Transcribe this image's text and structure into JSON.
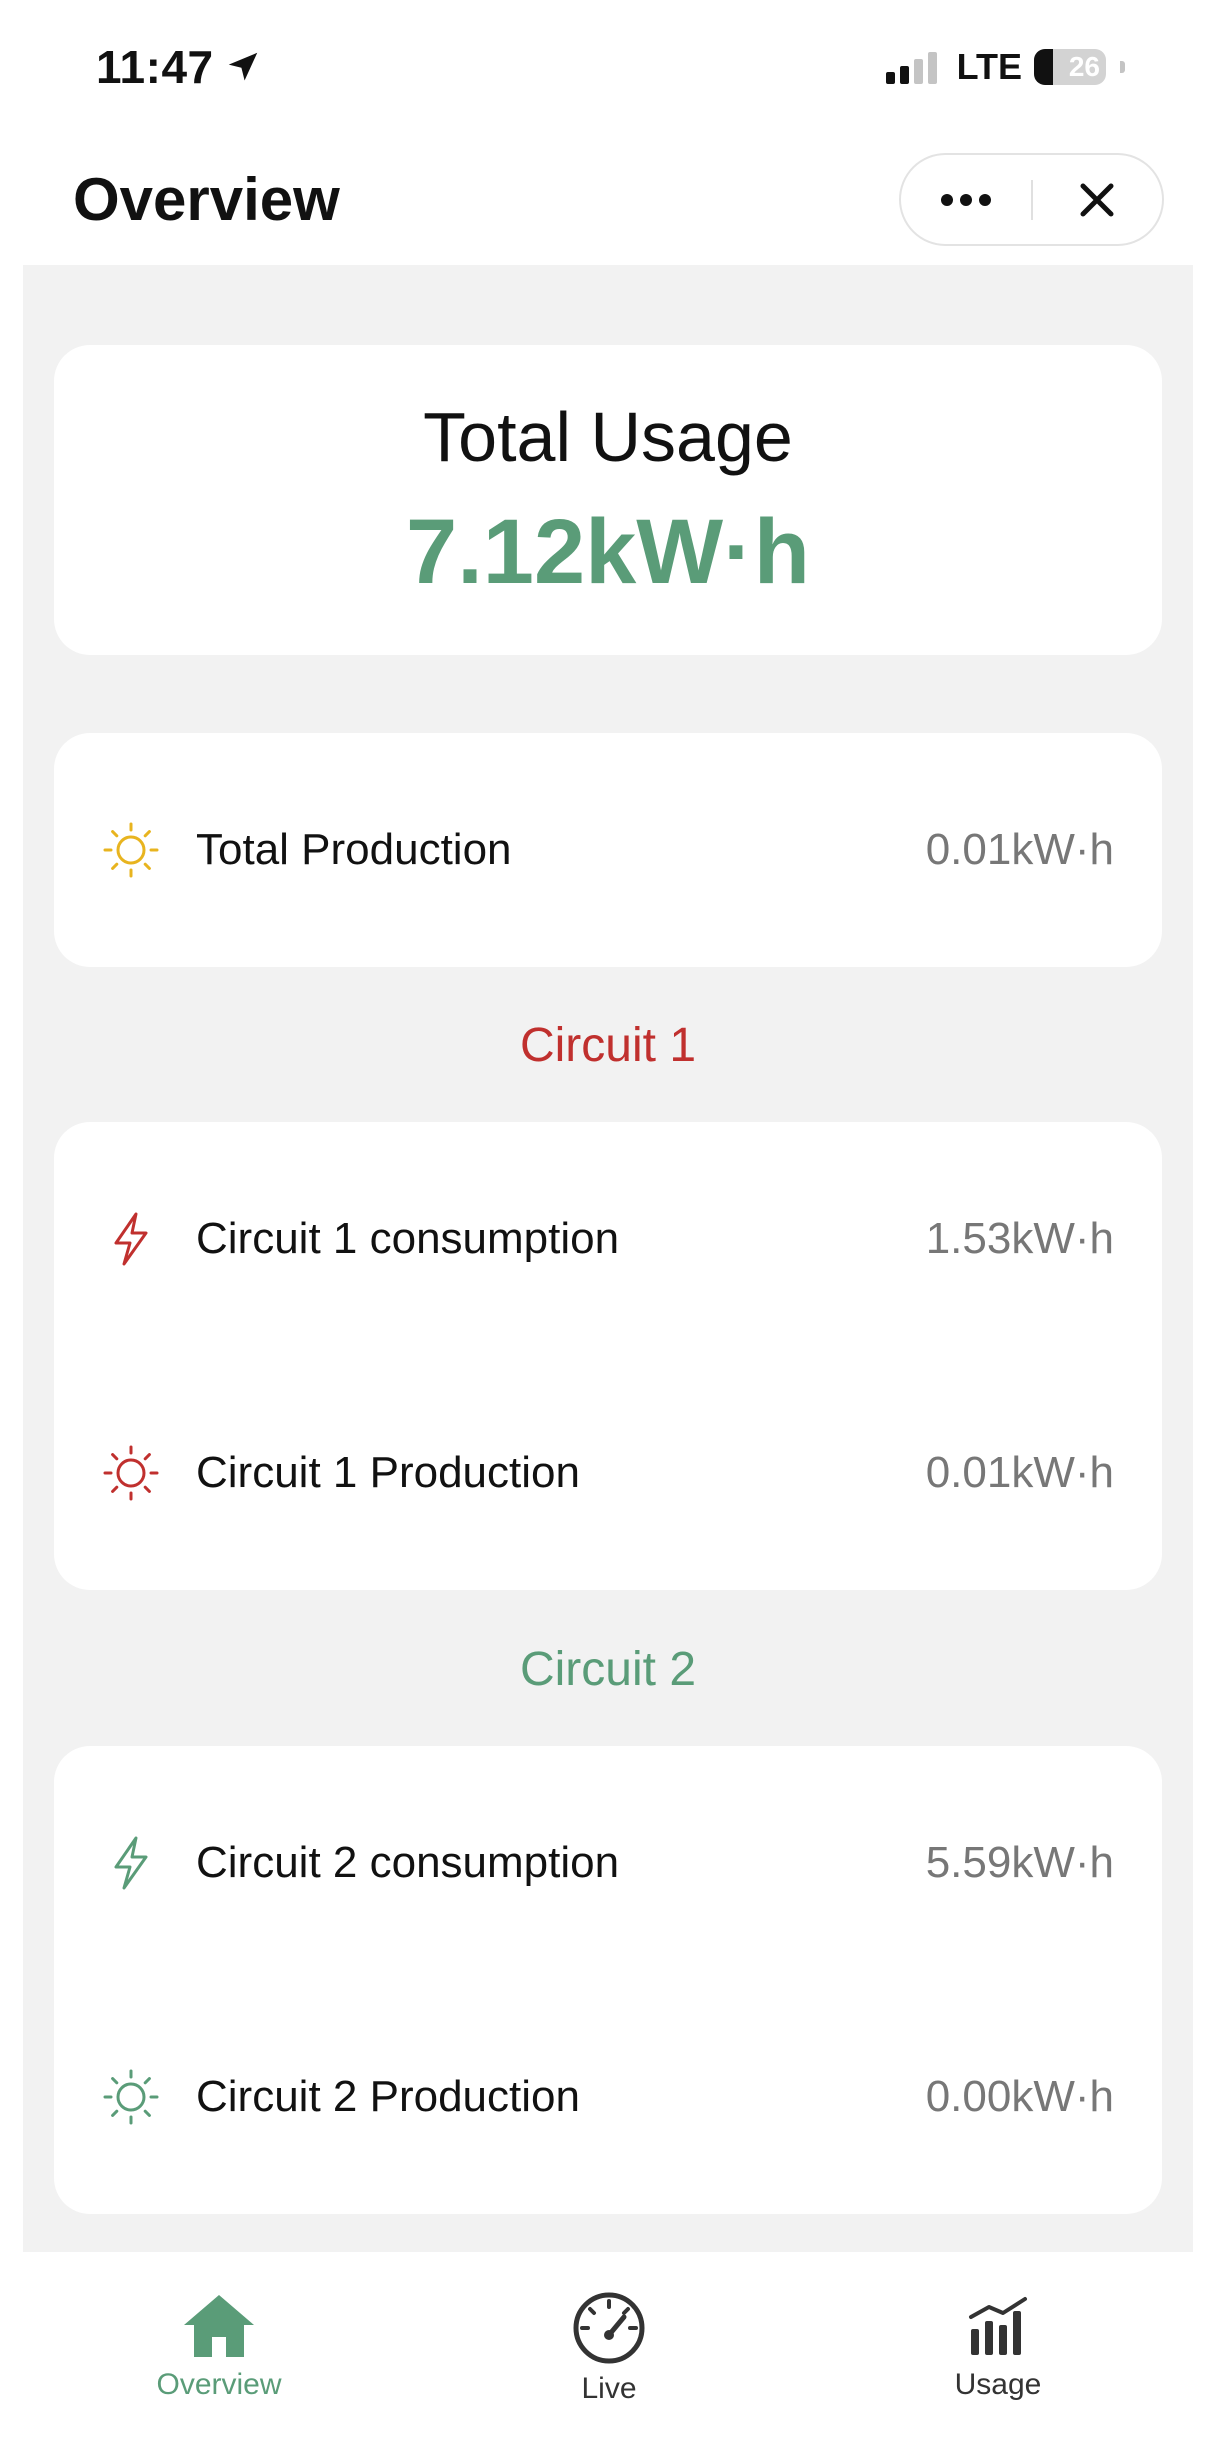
{
  "status_bar": {
    "time": "11:47",
    "network": "LTE",
    "battery": "26",
    "battery_fraction": 0.26
  },
  "header": {
    "title": "Overview"
  },
  "total_usage": {
    "title": "Total Usage",
    "value": "7.12kW·h"
  },
  "total_production": {
    "label": "Total Production",
    "value": "0.01kW·h"
  },
  "circuit1": {
    "title": "Circuit 1",
    "consumption_label": "Circuit 1 consumption",
    "consumption_value": "1.53kW·h",
    "production_label": "Circuit 1 Production",
    "production_value": "0.01kW·h"
  },
  "circuit2": {
    "title": "Circuit 2",
    "consumption_label": "Circuit 2 consumption",
    "consumption_value": "5.59kW·h",
    "production_label": "Circuit 2 Production",
    "production_value": "0.00kW·h"
  },
  "tabs": [
    {
      "label": "Overview",
      "icon": "home-icon",
      "active": true
    },
    {
      "label": "Live",
      "icon": "speedometer-icon",
      "active": false
    },
    {
      "label": "Usage",
      "icon": "bar-chart-icon",
      "active": false
    }
  ],
  "colors": {
    "accent_green": "#5a9c78",
    "circuit1_red": "#c0302e",
    "sun_yellow": "#e8b41f",
    "background_gray": "#f2f2f2"
  }
}
